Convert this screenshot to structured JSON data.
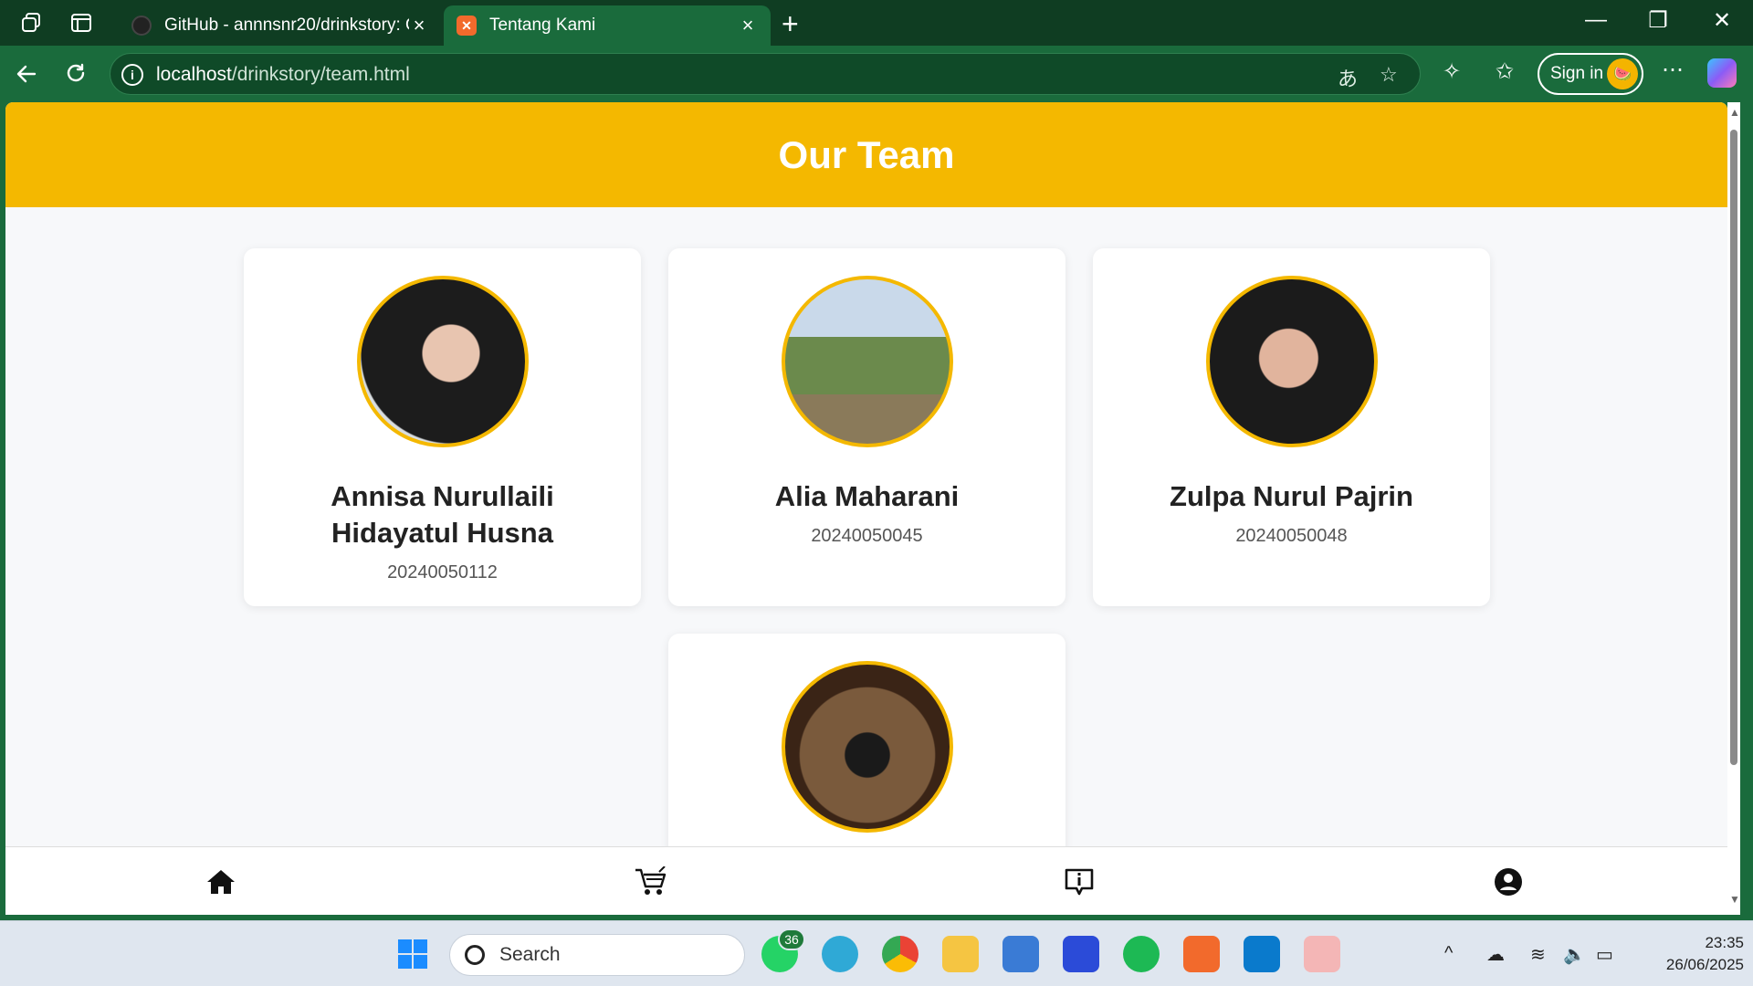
{
  "browser": {
    "tabs": [
      {
        "title": "GitHub - annnsnr20/drinkstory: O",
        "active": false
      },
      {
        "title": "Tentang Kami",
        "active": true
      }
    ],
    "url_host": "localhost",
    "url_path": "/drinkstory/team.html",
    "sign_in_label": "Sign in"
  },
  "page": {
    "title": "Our Team",
    "members": [
      {
        "name": "Annisa Nurullaili Hidayatul Husna",
        "nim": "20240050112"
      },
      {
        "name": "Alia Maharani",
        "nim": "20240050045"
      },
      {
        "name": "Zulpa Nurul Pajrin",
        "nim": "20240050048"
      },
      {
        "name": "",
        "nim": ""
      }
    ],
    "bottom_nav": [
      {
        "icon": "home-icon"
      },
      {
        "icon": "cart-icon"
      },
      {
        "icon": "info-icon"
      },
      {
        "icon": "user-icon"
      }
    ],
    "colors": {
      "accent": "#f4b800",
      "browser": "#1a6b3c"
    }
  },
  "taskbar": {
    "search_label": "Search",
    "whatsapp_badge": "36",
    "time": "23:35",
    "date": "26/06/2025"
  }
}
